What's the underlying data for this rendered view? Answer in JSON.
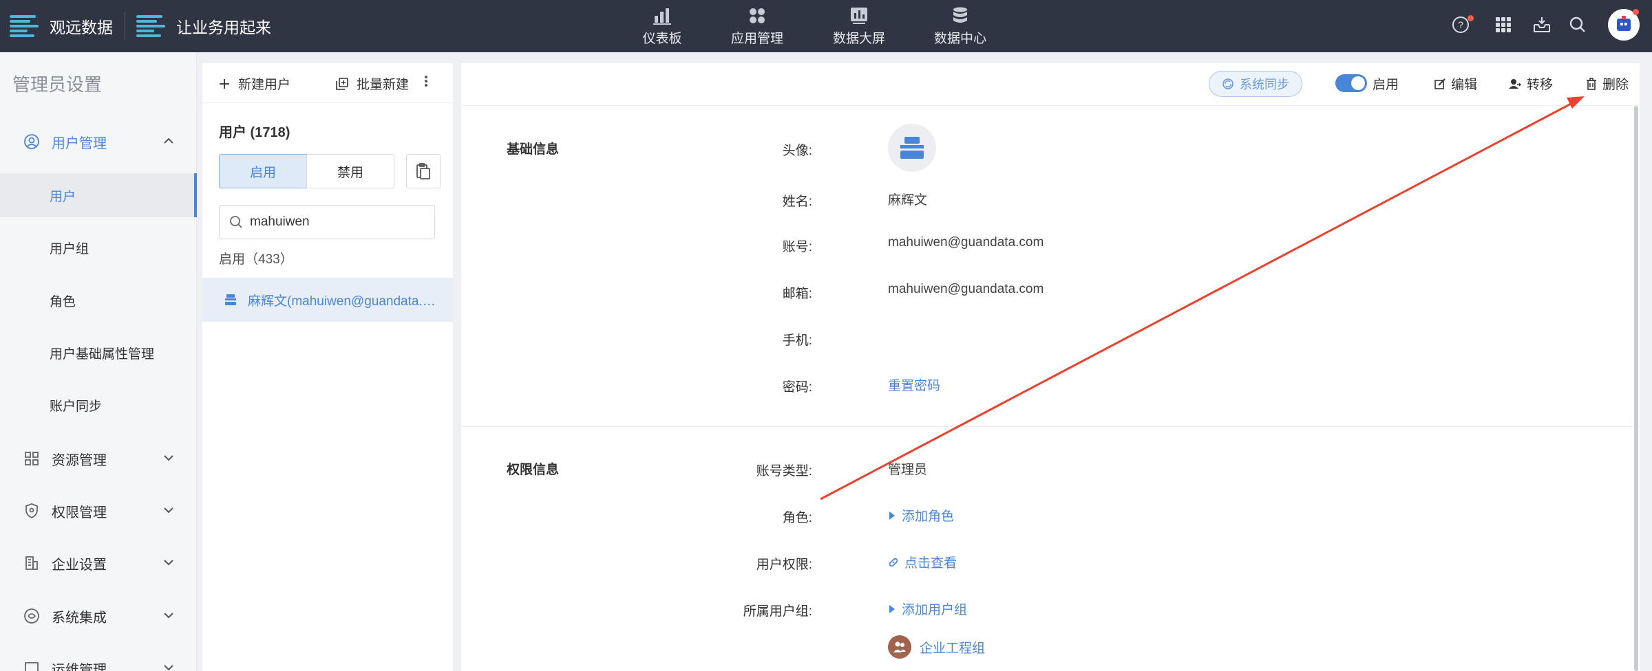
{
  "topbar": {
    "brand1": "观远数据",
    "brand2": "让业务用起来",
    "nav": [
      {
        "label": "仪表板"
      },
      {
        "label": "应用管理"
      },
      {
        "label": "数据大屏"
      },
      {
        "label": "数据中心"
      }
    ]
  },
  "sidebar": {
    "title": "管理员设置",
    "user_management": "用户管理",
    "sub_items": [
      "用户",
      "用户组",
      "角色",
      "用户基础属性管理",
      "账户同步"
    ],
    "resource": "资源管理",
    "permission": "权限管理",
    "enterprise": "企业设置",
    "integration": "系统集成",
    "ops": "运维管理"
  },
  "userlist": {
    "new_user": "新建用户",
    "batch_new": "批量新建",
    "count_title": "用户 (1718)",
    "tab_enabled": "启用",
    "tab_disabled": "禁用",
    "search_value": "mahuiwen",
    "enabled_count": "启用（433）",
    "selected_user": "麻辉文(mahuiwen@guandata.com)"
  },
  "detail": {
    "toolbar": {
      "sync": "系统同步",
      "enable": "启用",
      "edit": "编辑",
      "transfer": "转移",
      "delete": "删除"
    },
    "basic_section": "基础信息",
    "labels": {
      "avatar": "头像:",
      "name": "姓名:",
      "account": "账号:",
      "email": "邮箱:",
      "phone": "手机:",
      "password": "密码:"
    },
    "values": {
      "name": "麻辉文",
      "account": "mahuiwen@guandata.com",
      "email": "mahuiwen@guandata.com",
      "phone": "",
      "reset_password": "重置密码"
    },
    "perm_section": "权限信息",
    "perm_labels": {
      "account_type": "账号类型:",
      "role": "角色:",
      "user_perm": "用户权限:",
      "user_group": "所属用户组:"
    },
    "perm_values": {
      "account_type": "管理员",
      "add_role": "添加角色",
      "view": "点击查看",
      "add_group": "添加用户组",
      "group_name": "企业工程组"
    }
  },
  "colors": {
    "topbar": "#2f3542",
    "accent": "#4a86d8",
    "annotation_arrow": "#e8432f"
  }
}
